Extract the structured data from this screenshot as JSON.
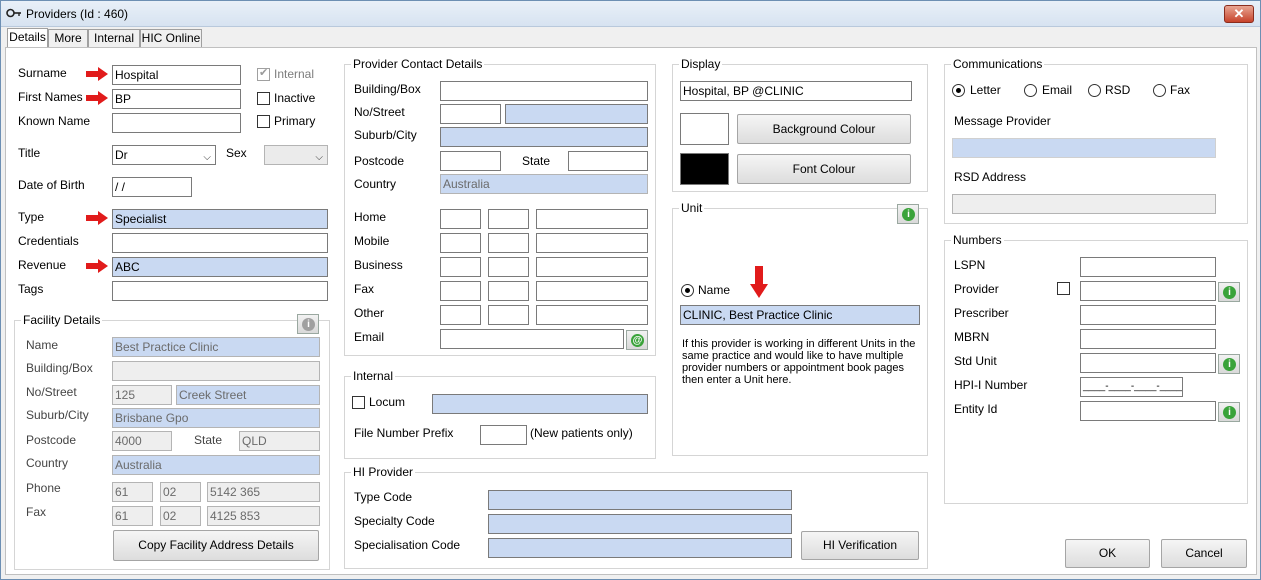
{
  "window": {
    "title": "Providers (Id : 460)",
    "close": "✕"
  },
  "tabs": [
    "Details",
    "More",
    "Internal",
    "HIC Online"
  ],
  "personal": {
    "surname_label": "Surname",
    "surname": "Hospital",
    "first_names_label": "First Names",
    "first_names": "BP",
    "known_name_label": "Known Name",
    "known_name": "",
    "title_label": "Title",
    "title": "Dr",
    "sex_label": "Sex",
    "sex": "",
    "dob_label": "Date of Birth",
    "dob": " /  /",
    "type_label": "Type",
    "type": "Specialist",
    "credentials_label": "Credentials",
    "credentials": "",
    "revenue_label": "Revenue",
    "revenue": "ABC",
    "tags_label": "Tags",
    "tags": "",
    "internal_label": "Internal",
    "internal_checked": true,
    "inactive_label": "Inactive",
    "primary_label": "Primary"
  },
  "facility": {
    "title": "Facility Details",
    "name_label": "Name",
    "name": "Best Practice Clinic",
    "building_label": "Building/Box",
    "building": "",
    "street_label": "No/Street",
    "street_no": "125",
    "street": "Creek Street",
    "suburb_label": "Suburb/City",
    "suburb": "Brisbane Gpo",
    "postcode_label": "Postcode",
    "postcode": "4000",
    "state_label": "State",
    "state": "QLD",
    "country_label": "Country",
    "country": "Australia",
    "phone_label": "Phone",
    "phone": [
      "61",
      "02",
      "5142 365"
    ],
    "fax_label": "Fax",
    "fax": [
      "61",
      "02",
      "4125 853"
    ],
    "copy_button": "Copy Facility Address Details"
  },
  "contact": {
    "title": "Provider Contact Details",
    "building_label": "Building/Box",
    "street_label": "No/Street",
    "suburb_label": "Suburb/City",
    "postcode_label": "Postcode",
    "state_label": "State",
    "country_label": "Country",
    "country": "Australia",
    "home_label": "Home",
    "mobile_label": "Mobile",
    "business_label": "Business",
    "fax_label": "Fax",
    "other_label": "Other",
    "email_label": "Email",
    "email_icon": "@"
  },
  "internal": {
    "title": "Internal",
    "locum_label": "Locum",
    "prefix_label": "File Number Prefix",
    "prefix_note": "(New patients only)"
  },
  "hi_provider": {
    "title": "HI Provider",
    "type_code_label": "Type Code",
    "specialty_code_label": "Specialty Code",
    "specialisation_code_label": "Specialisation Code",
    "verify_button": "HI Verification"
  },
  "display": {
    "title": "Display",
    "value": "Hospital, BP @CLINIC",
    "background_button": "Background Colour",
    "font_button": "Font Colour",
    "background_color": "#ffffff",
    "font_color": "#000000"
  },
  "unit": {
    "title": "Unit",
    "name_label": "Name",
    "name": "CLINIC, Best Practice Clinic",
    "note": "If this provider is working in different Units in the same practice and would like to have multiple provider numbers or appointment book pages then enter a Unit here."
  },
  "communications": {
    "title": "Communications",
    "options": [
      "Letter",
      "Email",
      "RSD",
      "Fax"
    ],
    "selected": "Letter",
    "message_label": "Message Provider",
    "rsd_label": "RSD Address"
  },
  "numbers": {
    "title": "Numbers",
    "lspn_label": "LSPN",
    "provider_label": "Provider",
    "prescriber_label": "Prescriber",
    "mbrn_label": "MBRN",
    "std_unit_label": "Std Unit",
    "hpii_label": "HPI-I Number",
    "hpii_mask": "____-____-____-____",
    "entity_label": "Entity Id"
  },
  "footer": {
    "ok": "OK",
    "cancel": "Cancel"
  },
  "colors": {
    "highlight_field": "#c9d9f2",
    "arrow": "#e11b1b",
    "info_green": "#3aa33a"
  }
}
